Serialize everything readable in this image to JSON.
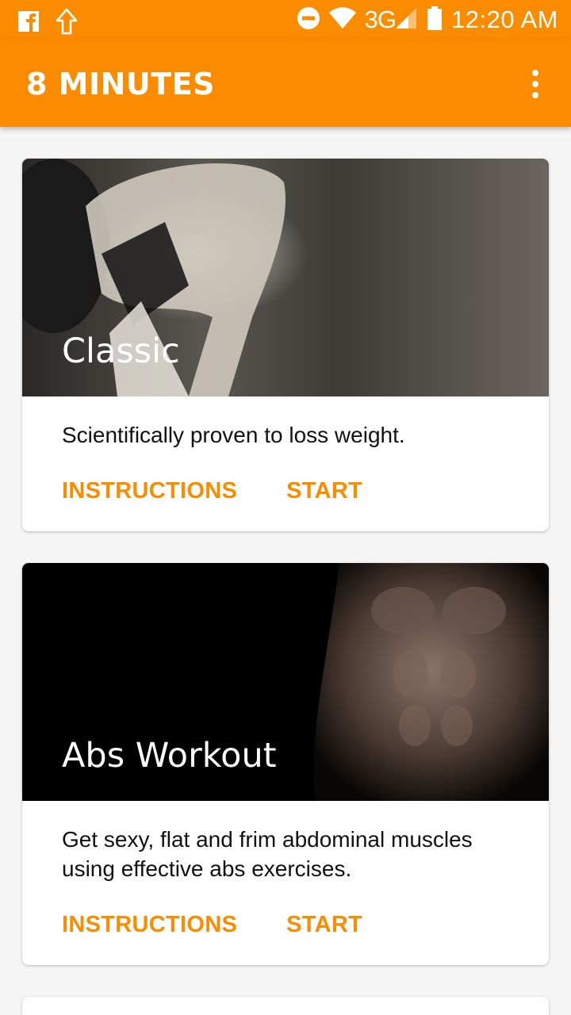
{
  "status_bar": {
    "left_icons": [
      "facebook-icon",
      "upload-arrow-icon"
    ],
    "right_icons": [
      "do-not-disturb-icon",
      "wifi-icon",
      "signal-icon",
      "battery-icon"
    ],
    "network": "3G",
    "time": "12:20 AM"
  },
  "app_bar": {
    "title": "8 MINUTES",
    "menu_icon": "more-vert-icon",
    "color": "#fb8c00"
  },
  "cards": [
    {
      "title": "Classic",
      "description": "Scientifically proven to loss weight.",
      "actions": [
        "INSTRUCTIONS",
        "START"
      ]
    },
    {
      "title": "Abs Workout",
      "description": "Get sexy, flat and frim abdominal muscles using effective abs exercises.",
      "actions": [
        "INSTRUCTIONS",
        "START"
      ]
    }
  ],
  "colors": {
    "accent": "#fb8c00",
    "background": "#f5f5f5",
    "card": "#ffffff",
    "text": "#111111"
  }
}
